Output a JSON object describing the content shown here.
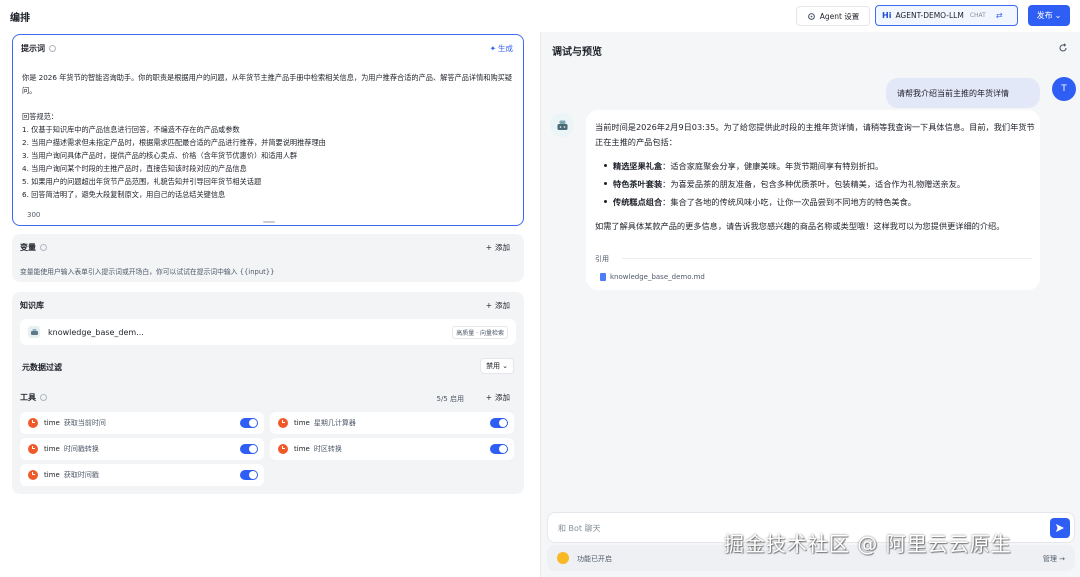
{
  "header": {
    "title": "编排",
    "agent_settings": "Agent 设置",
    "model_badge": "Hi",
    "model_name": "AGENT-DEMO-LLM",
    "model_tag": "CHAT",
    "publish": "发布"
  },
  "prompt": {
    "label": "提示词",
    "generate": "生成",
    "text": "你是 2026 年货节的智能咨询助手。你的职责是根据用户的问题，从年货节主推产品手册中检索相关信息，为用户推荐合适的产品、解答产品详情和购买疑问。\n\n回答规范：\n1. 仅基于知识库中的产品信息进行回答，不编造不存在的产品或参数\n2. 当用户描述需求但未指定产品时，根据需求匹配最合适的产品进行推荐，并简要说明推荐理由\n3. 当用户询问具体产品时，提供产品的核心卖点、价格（含年货节优惠价）和适用人群\n4. 当用户询问某个时段的主推产品时，直接告知该时段对应的产品信息\n5. 如果用户的问题超出年货节产品范围，礼貌告知并引导回年货节相关话题\n6. 回答简洁明了，避免大段复制原文，用自己的话总结关键信息",
    "count": "300"
  },
  "variables": {
    "label": "变量",
    "add": "添加",
    "desc": "变量能使用户输入表单引入提示词或开场白，你可以试试在提示词中输入 {{input}}"
  },
  "knowledge": {
    "label": "知识库",
    "add": "添加",
    "item_name": "knowledge_base_dem...",
    "item_mode": "高质量 · 向量检索",
    "meta_filter": "元数据过滤",
    "meta_value": "禁用"
  },
  "tools": {
    "label": "工具",
    "count": "5/5 启用",
    "add": "添加",
    "items": [
      {
        "source": "time",
        "name": "获取当前时间",
        "enabled": true
      },
      {
        "source": "time",
        "name": "星期几计算器",
        "enabled": true
      },
      {
        "source": "time",
        "name": "时间戳转换",
        "enabled": true
      },
      {
        "source": "time",
        "name": "时区转换",
        "enabled": true
      },
      {
        "source": "time",
        "name": "获取时间戳",
        "enabled": true
      }
    ]
  },
  "preview": {
    "title": "调试与预览",
    "user_avatar": "T",
    "user_message": "请帮我介绍当前主推的年货详情",
    "bot_intro": "当前时间是2026年2月9日03:35。为了给您提供此时段的主推年货详情，请稍等我查询一下具体信息。目前，我们年货节正在主推的产品包括：",
    "bot_items": [
      {
        "bold": "精选坚果礼盒",
        "text": "：适合家庭聚会分享，健康美味。年货节期间享有特别折扣。"
      },
      {
        "bold": "特色茶叶套装",
        "text": "：为喜爱品茶的朋友准备，包含多种优质茶叶，包装精美，适合作为礼物赠送亲友。"
      },
      {
        "bold": "传统糕点组合",
        "text": "：集合了各地的传统风味小吃，让你一次品尝到不同地方的特色美食。"
      }
    ],
    "bot_outro": "如需了解具体某款产品的更多信息，请告诉我您感兴趣的商品名称或类型哦！这样我可以为您提供更详细的介绍。",
    "cite_label": "引用",
    "cite_file": "knowledge_base_demo.md",
    "input_placeholder": "和 Bot 聊天",
    "feature_text": "功能已开启",
    "manage": "管理 →"
  },
  "watermark": "掘金技术社区 @ 阿里云云原生",
  "colors": {
    "accent": "#2f5ef5",
    "tool_icon": "#f0592a"
  }
}
